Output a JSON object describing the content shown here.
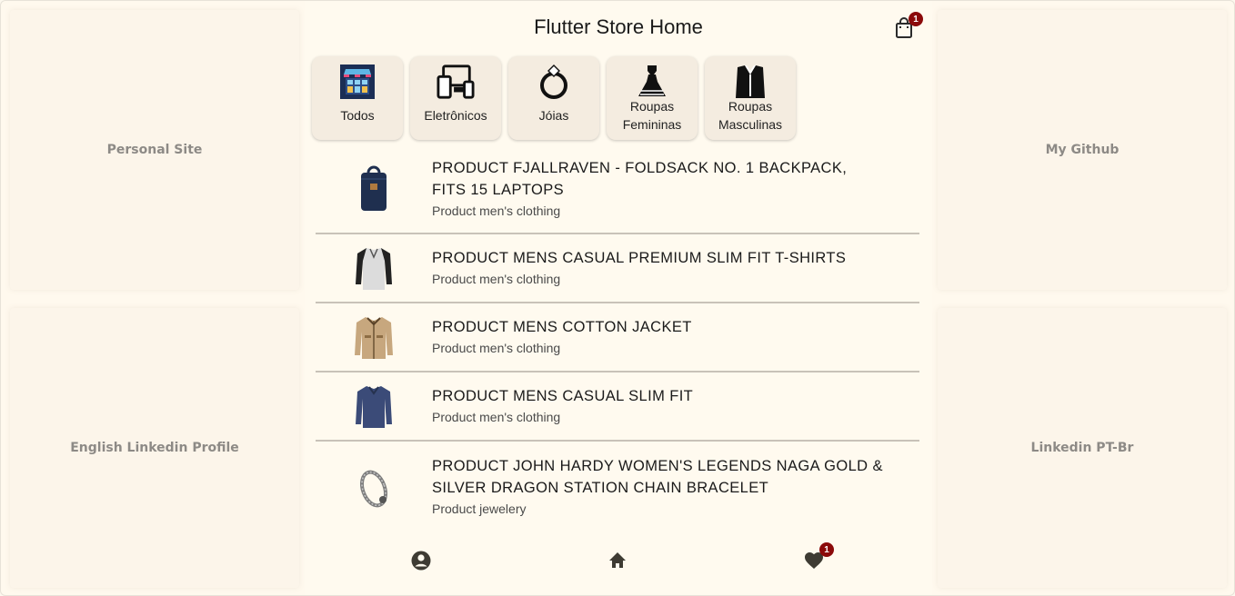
{
  "side_links": {
    "left_top": "Personal Site",
    "left_bottom": "English Linkedin Profile",
    "right_top": "My Github",
    "right_bottom": "Linkedin PT-Br"
  },
  "appbar": {
    "title": "Flutter Store Home",
    "cart_icon": "shopping-bag-icon",
    "cart_badge": "1"
  },
  "categories": [
    {
      "label": "Todos",
      "icon": "store-icon"
    },
    {
      "label": "Eletrônicos",
      "icon": "devices-icon"
    },
    {
      "label": "Jóias",
      "icon": "ring-icon"
    },
    {
      "label": "Roupas Femininas",
      "icon": "dress-icon"
    },
    {
      "label": "Roupas Masculinas",
      "icon": "suit-icon"
    }
  ],
  "products": [
    {
      "title": "PRODUCT FJALLRAVEN - FOLDSACK NO. 1 BACKPACK, FITS 15 LAPTOPS",
      "category": "Product men's clothing",
      "image": "backpack-image"
    },
    {
      "title": "PRODUCT MENS CASUAL PREMIUM SLIM FIT T-SHIRTS",
      "category": "Product men's clothing",
      "image": "tshirt-image"
    },
    {
      "title": "PRODUCT MENS COTTON JACKET",
      "category": "Product men's clothing",
      "image": "jacket-image"
    },
    {
      "title": "PRODUCT MENS CASUAL SLIM FIT",
      "category": "Product men's clothing",
      "image": "longsleeve-image"
    },
    {
      "title": "PRODUCT JOHN HARDY WOMEN'S LEGENDS NAGA GOLD & SILVER DRAGON STATION CHAIN BRACELET",
      "category": "Product jewelery",
      "image": "bracelet-image"
    }
  ],
  "bottom_nav": {
    "profile_icon": "account-circle-icon",
    "home_icon": "home-icon",
    "favorites_icon": "heart-icon",
    "favorites_badge": "1"
  },
  "colors": {
    "background": "#fff9ee",
    "card": "#f4ece0",
    "badge": "#8b0a0a",
    "icon": "#3e3b33"
  }
}
